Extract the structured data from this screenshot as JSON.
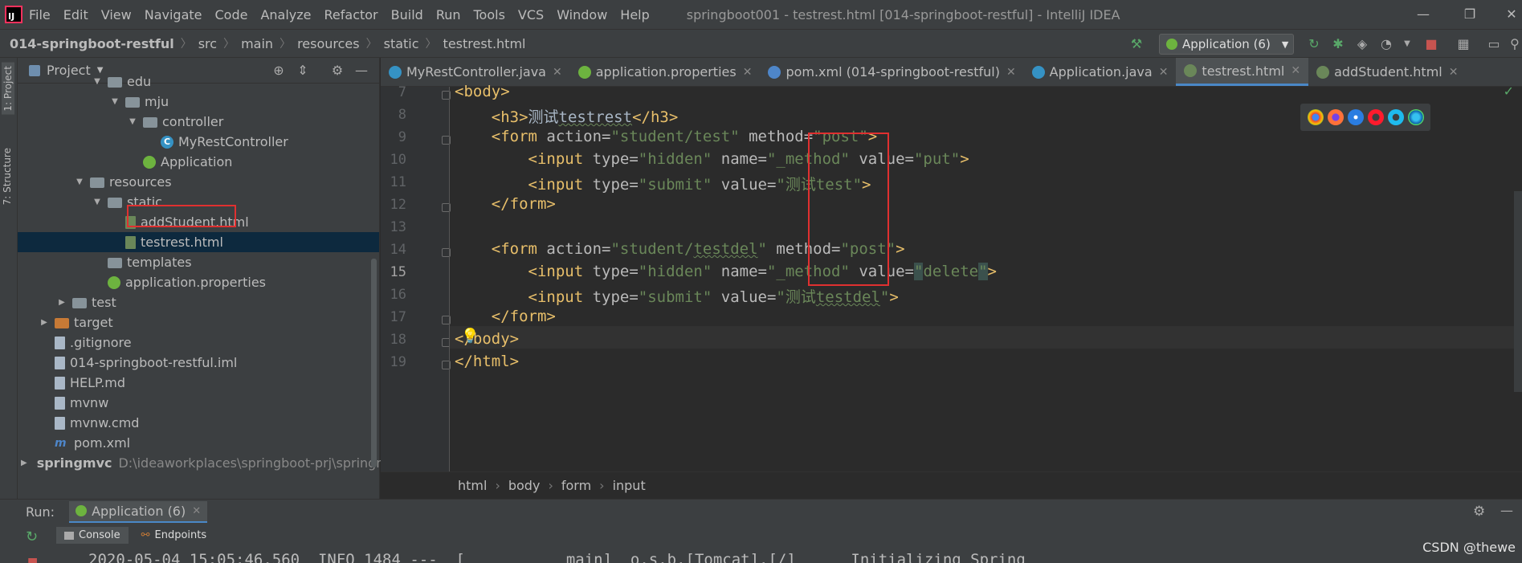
{
  "menubar": {
    "items": [
      "File",
      "Edit",
      "View",
      "Navigate",
      "Code",
      "Analyze",
      "Refactor",
      "Build",
      "Run",
      "Tools",
      "VCS",
      "Window",
      "Help"
    ],
    "window_title": "springboot001 - testrest.html [014-springboot-restful] - IntelliJ IDEA"
  },
  "navbar": {
    "crumbs": [
      "014-springboot-restful",
      "src",
      "main",
      "resources",
      "static",
      "testrest.html"
    ],
    "run_config": "Application (6)"
  },
  "left_strip": {
    "project_tab": "1: Project",
    "structure_tab": "7: Structure"
  },
  "project": {
    "title": "Project",
    "tree": [
      {
        "label": "edu",
        "kind": "folder",
        "indent": 5,
        "arrow": "▼"
      },
      {
        "label": "mju",
        "kind": "folder",
        "indent": 6,
        "arrow": "▼"
      },
      {
        "label": "controller",
        "kind": "folder",
        "indent": 7,
        "arrow": "▼"
      },
      {
        "label": "MyRestController",
        "kind": "class",
        "indent": 8,
        "arrow": ""
      },
      {
        "label": "Application",
        "kind": "spring",
        "indent": 7,
        "arrow": ""
      },
      {
        "label": "resources",
        "kind": "folder",
        "indent": 4,
        "arrow": "▼"
      },
      {
        "label": "static",
        "kind": "folder",
        "indent": 5,
        "arrow": "▼"
      },
      {
        "label": "addStudent.html",
        "kind": "html",
        "indent": 6,
        "arrow": ""
      },
      {
        "label": "testrest.html",
        "kind": "html",
        "indent": 6,
        "arrow": "",
        "selected": true
      },
      {
        "label": "templates",
        "kind": "folder",
        "indent": 5,
        "arrow": ""
      },
      {
        "label": "application.properties",
        "kind": "spring",
        "indent": 5,
        "arrow": ""
      },
      {
        "label": "test",
        "kind": "folder",
        "indent": 3,
        "arrow": "▶"
      },
      {
        "label": "target",
        "kind": "folder-orange",
        "indent": 2,
        "arrow": "▶"
      },
      {
        "label": ".gitignore",
        "kind": "file",
        "indent": 2,
        "arrow": ""
      },
      {
        "label": "014-springboot-restful.iml",
        "kind": "file",
        "indent": 2,
        "arrow": ""
      },
      {
        "label": "HELP.md",
        "kind": "file",
        "indent": 2,
        "arrow": ""
      },
      {
        "label": "mvnw",
        "kind": "file",
        "indent": 2,
        "arrow": ""
      },
      {
        "label": "mvnw.cmd",
        "kind": "file",
        "indent": 2,
        "arrow": ""
      },
      {
        "label": "pom.xml",
        "kind": "maven",
        "indent": 2,
        "arrow": ""
      },
      {
        "label": "springmvc",
        "kind": "folder",
        "indent": 1,
        "arrow": "▶",
        "bold": true,
        "path": "D:\\ideaworkplaces\\springboot-prj\\springm"
      }
    ]
  },
  "editor_tabs": [
    {
      "label": "MyRestController.java",
      "icon_color": "#3592c4",
      "active": false
    },
    {
      "label": "application.properties",
      "icon_color": "#6db33f",
      "active": false
    },
    {
      "label": "pom.xml (014-springboot-restful)",
      "icon_color": "#4e86c9",
      "active": false
    },
    {
      "label": "Application.java",
      "icon_color": "#3592c4",
      "active": false
    },
    {
      "label": "testrest.html",
      "icon_color": "#6a8759",
      "active": true
    },
    {
      "label": "addStudent.html",
      "icon_color": "#6a8759",
      "active": false
    }
  ],
  "editor": {
    "line_numbers": [
      "7",
      "8",
      "9",
      "10",
      "11",
      "12",
      "13",
      "14",
      "15",
      "16",
      "17",
      "18",
      "19"
    ],
    "current_line": "15",
    "lines": [
      [
        {
          "t": "<body>",
          "c": "tag"
        }
      ],
      [
        {
          "t": "    ",
          "c": "txt"
        },
        {
          "t": "<h3>",
          "c": "tag"
        },
        {
          "t": "测试",
          "c": "txt"
        },
        {
          "t": "testrest",
          "c": "txt squig"
        },
        {
          "t": "</h3>",
          "c": "tag"
        }
      ],
      [
        {
          "t": "    ",
          "c": "txt"
        },
        {
          "t": "<form ",
          "c": "tag"
        },
        {
          "t": "action=",
          "c": "attr"
        },
        {
          "t": "\"student/test\"",
          "c": "str"
        },
        {
          "t": " method=",
          "c": "attr"
        },
        {
          "t": "\"post\"",
          "c": "str"
        },
        {
          "t": ">",
          "c": "tag"
        }
      ],
      [
        {
          "t": "        ",
          "c": "txt"
        },
        {
          "t": "<input ",
          "c": "tag"
        },
        {
          "t": "type=",
          "c": "attr"
        },
        {
          "t": "\"hidden\"",
          "c": "str"
        },
        {
          "t": " name=",
          "c": "attr"
        },
        {
          "t": "\"_method\"",
          "c": "str"
        },
        {
          "t": " value=",
          "c": "attr"
        },
        {
          "t": "\"put\"",
          "c": "str"
        },
        {
          "t": ">",
          "c": "tag"
        }
      ],
      [
        {
          "t": "        ",
          "c": "txt"
        },
        {
          "t": "<input ",
          "c": "tag"
        },
        {
          "t": "type=",
          "c": "attr"
        },
        {
          "t": "\"submit\"",
          "c": "str"
        },
        {
          "t": " value=",
          "c": "attr"
        },
        {
          "t": "\"测试test\"",
          "c": "str"
        },
        {
          "t": ">",
          "c": "tag"
        }
      ],
      [
        {
          "t": "    ",
          "c": "txt"
        },
        {
          "t": "</form>",
          "c": "tag"
        }
      ],
      [
        {
          "t": "",
          "c": "txt"
        }
      ],
      [
        {
          "t": "    ",
          "c": "txt"
        },
        {
          "t": "<form ",
          "c": "tag"
        },
        {
          "t": "action=",
          "c": "attr"
        },
        {
          "t": "\"student/",
          "c": "str"
        },
        {
          "t": "testdel",
          "c": "str squig"
        },
        {
          "t": "\"",
          "c": "str"
        },
        {
          "t": " method=",
          "c": "attr"
        },
        {
          "t": "\"post\"",
          "c": "str"
        },
        {
          "t": ">",
          "c": "tag"
        }
      ],
      [
        {
          "t": "        ",
          "c": "txt"
        },
        {
          "t": "<input ",
          "c": "tag"
        },
        {
          "t": "type=",
          "c": "attr"
        },
        {
          "t": "\"hidden\"",
          "c": "str"
        },
        {
          "t": " name=",
          "c": "attr"
        },
        {
          "t": "\"_method\"",
          "c": "str"
        },
        {
          "t": " value=",
          "c": "attr"
        },
        {
          "t": "\"",
          "c": "str hl"
        },
        {
          "t": "delete",
          "c": "str"
        },
        {
          "t": "\"",
          "c": "str hl"
        },
        {
          "t": ">",
          "c": "tag"
        }
      ],
      [
        {
          "t": "        ",
          "c": "txt"
        },
        {
          "t": "<input ",
          "c": "tag"
        },
        {
          "t": "type=",
          "c": "attr"
        },
        {
          "t": "\"submit\"",
          "c": "str"
        },
        {
          "t": " value=",
          "c": "attr"
        },
        {
          "t": "\"测试",
          "c": "str"
        },
        {
          "t": "testdel",
          "c": "str squig"
        },
        {
          "t": "\"",
          "c": "str"
        },
        {
          "t": ">",
          "c": "tag"
        }
      ],
      [
        {
          "t": "    ",
          "c": "txt"
        },
        {
          "t": "</form>",
          "c": "tag"
        }
      ],
      [
        {
          "t": "</body>",
          "c": "tag"
        }
      ],
      [
        {
          "t": "</html>",
          "c": "tag"
        }
      ]
    ]
  },
  "editor_breadcrumb": [
    "html",
    "body",
    "form",
    "input"
  ],
  "run_panel": {
    "label": "Run:",
    "tab": "Application (6)",
    "subtabs": [
      "Console",
      "Endpoints"
    ],
    "log_partial": "2020-05-04 15:05:46.560  INFO 1484 ---  [           main]  o.s.b.[Tomcat].[/]      Initializing Spring"
  },
  "watermark": "CSDN @thewe"
}
